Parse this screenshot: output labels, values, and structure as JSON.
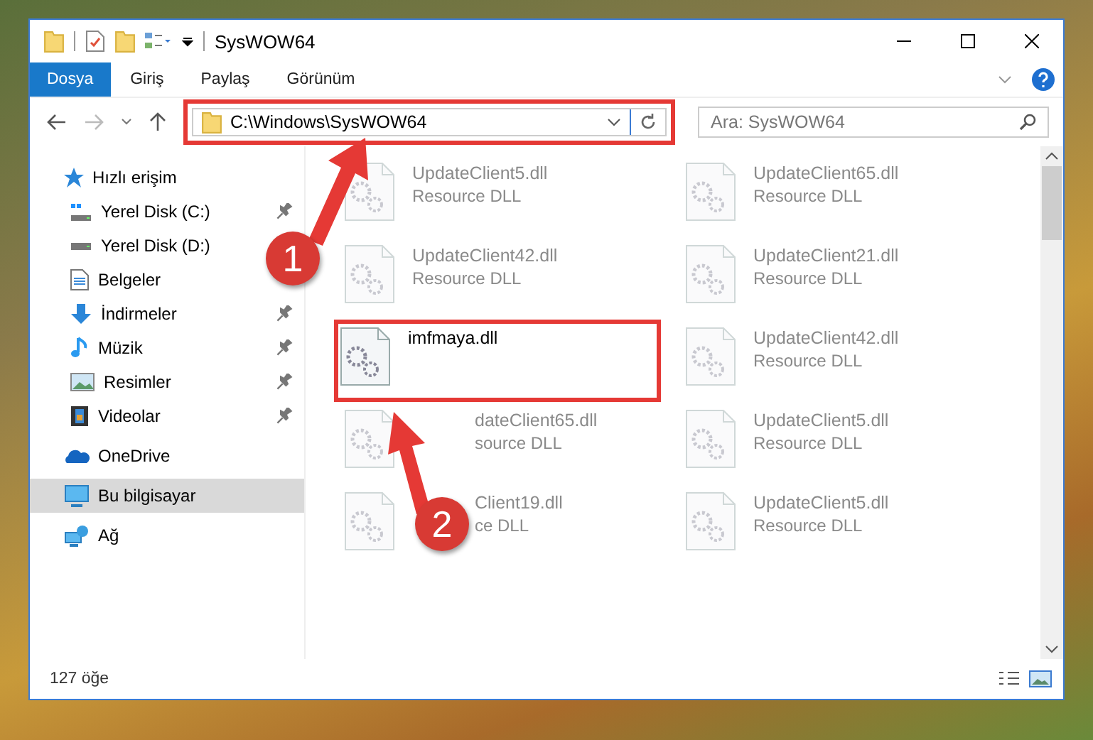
{
  "window": {
    "title": "SysWOW64"
  },
  "ribbon": {
    "tabs": [
      {
        "label": "Dosya",
        "selected": true
      },
      {
        "label": "Giriş",
        "selected": false
      },
      {
        "label": "Paylaş",
        "selected": false
      },
      {
        "label": "Görünüm",
        "selected": false
      }
    ]
  },
  "address_bar": {
    "path": "C:\\Windows\\SysWOW64",
    "highlighted": true
  },
  "search": {
    "placeholder": "Ara: SysWOW64"
  },
  "sidebar": {
    "items": [
      {
        "label": "Hızlı erişim",
        "kind": "star",
        "selected": false,
        "children": [
          {
            "label": "Yerel Disk (C:)",
            "kind": "drive-win",
            "pinned": true,
            "selected": false
          },
          {
            "label": "Yerel Disk (D:)",
            "kind": "drive",
            "pinned": false,
            "selected": false
          },
          {
            "label": "Belgeler",
            "kind": "docs",
            "pinned": false,
            "selected": false
          },
          {
            "label": "İndirmeler",
            "kind": "download",
            "pinned": true,
            "selected": false
          },
          {
            "label": "Müzik",
            "kind": "music",
            "pinned": true,
            "selected": false
          },
          {
            "label": "Resimler",
            "kind": "pictures",
            "pinned": true,
            "selected": false
          },
          {
            "label": "Videolar",
            "kind": "videos",
            "pinned": true,
            "selected": false
          }
        ]
      },
      {
        "label": "OneDrive",
        "kind": "cloud",
        "selected": false
      },
      {
        "label": "Bu bilgisayar",
        "kind": "pc",
        "selected": true
      },
      {
        "label": "Ağ",
        "kind": "network",
        "selected": false
      }
    ]
  },
  "files": [
    {
      "name": "UpdateClient5.dll",
      "type": "Resource DLL",
      "kind": "whole",
      "faded": true,
      "highlighted": false
    },
    {
      "name": "UpdateClient65.dll",
      "type": "Resource DLL",
      "kind": "whole",
      "faded": true,
      "highlighted": false
    },
    {
      "name": "UpdateClient42.dll",
      "type": "Resource DLL",
      "kind": "whole",
      "faded": true,
      "highlighted": false
    },
    {
      "name": "UpdateClient21.dll",
      "type": "Resource DLL",
      "kind": "whole",
      "faded": true,
      "highlighted": false
    },
    {
      "name": "imfmaya.dll",
      "kind": "whole",
      "faded": false,
      "highlighted": true
    },
    {
      "name": "UpdateClient42.dll",
      "type": "Resource DLL",
      "kind": "whole",
      "faded": true,
      "highlighted": false
    },
    {
      "name": "dateClient65.dll",
      "type": "source DLL",
      "kind": "partial",
      "faded": true,
      "highlighted": false
    },
    {
      "name": "UpdateClient5.dll",
      "type": "Resource DLL",
      "kind": "whole",
      "faded": true,
      "highlighted": false
    },
    {
      "name": "Client19.dll",
      "type": "ce DLL",
      "kind": "partial",
      "faded": true,
      "highlighted": false
    },
    {
      "name": "UpdateClient5.dll",
      "type": "Resource DLL",
      "kind": "whole",
      "faded": true,
      "highlighted": false
    }
  ],
  "status_bar": {
    "count": "127 öğe"
  },
  "annotations": [
    {
      "number": "1"
    },
    {
      "number": "2"
    }
  ]
}
